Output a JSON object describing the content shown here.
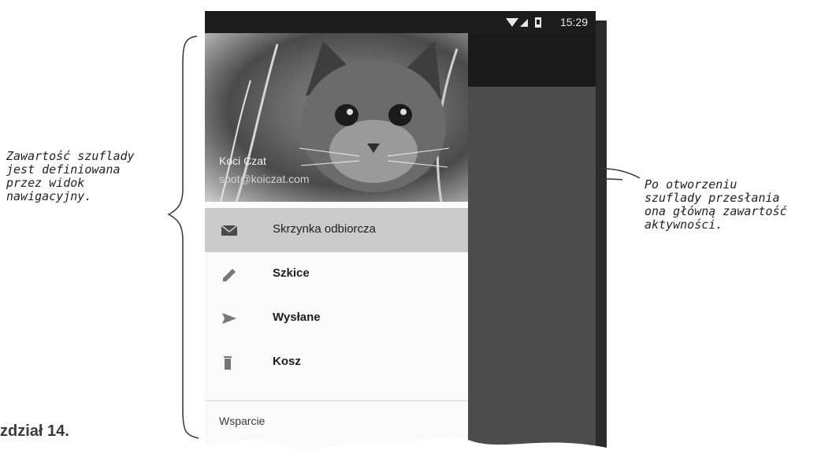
{
  "annotations": {
    "left": "Zawartość szuflady\njest definiowana\nprzez widok\nnawigacyjny.",
    "right": "Po otworzeniu\nszuflady przesłania\nona główną zawartość\naktywności."
  },
  "chapter_label": "zdział 14.",
  "status_bar": {
    "time": "15:29",
    "icons": [
      "wifi-icon",
      "signal-icon",
      "battery-icon"
    ]
  },
  "drawer": {
    "header": {
      "name": "Koci Czat",
      "email": "spot@koiczat.com"
    },
    "items": [
      {
        "label": "Skrzynka odbiorcza",
        "icon": "mail-icon",
        "selected": true
      },
      {
        "label": "Szkice",
        "icon": "pencil-icon",
        "selected": false
      },
      {
        "label": "Wysłane",
        "icon": "send-icon",
        "selected": false
      },
      {
        "label": "Kosz",
        "icon": "trash-icon",
        "selected": false
      }
    ],
    "support_label": "Wsparcie"
  },
  "colors": {
    "status_bar": "#1c1c1c",
    "app_bar": "#1a1a1a",
    "scrim": "#4c4c4c",
    "selected_item": "#cbcbcb"
  }
}
